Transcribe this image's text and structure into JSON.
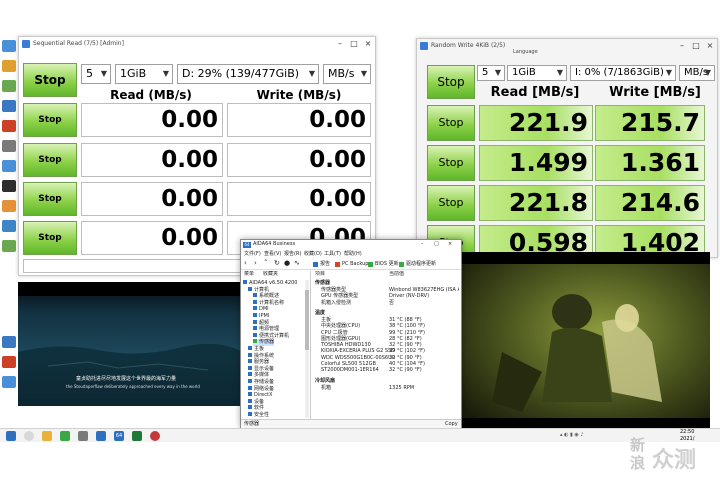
{
  "seq_window": {
    "title": "Sequential Read (7/5) [Admin]",
    "stop_main": "Stop",
    "count": "5",
    "size": "1GiB",
    "drive": "D: 29% (139/477GiB)",
    "unit": "MB/s",
    "read_header": "Read (MB/s)",
    "write_header": "Write (MB/s)",
    "rows": [
      {
        "stop": "Stop",
        "read": "0.00",
        "write": "0.00"
      },
      {
        "stop": "Stop",
        "read": "0.00",
        "write": "0.00"
      },
      {
        "stop": "Stop",
        "read": "0.00",
        "write": "0.00"
      },
      {
        "stop": "Stop",
        "read": "0.00",
        "write": "0.00"
      }
    ]
  },
  "rand_window": {
    "title": "Random Write 4KiB (2/5)",
    "menu": "Language",
    "stop_main": "Stop",
    "count": "5",
    "size": "1GiB",
    "drive": "I: 0% (7/1863GiB)",
    "unit": "MB/s",
    "read_header": "Read [MB/s]",
    "write_header": "Write [MB/s]",
    "rows": [
      {
        "stop": "Stop",
        "read": "221.9",
        "write": "215.7"
      },
      {
        "stop": "Stop",
        "read": "1.499",
        "write": "1.361"
      },
      {
        "stop": "Stop",
        "read": "221.8",
        "write": "214.6"
      },
      {
        "stop": "Stop",
        "read": "0.598",
        "write": "1.402"
      }
    ]
  },
  "aida": {
    "title": "AIDA64 Business",
    "menu": [
      "文件(F)",
      "查看(V)",
      "报告(R)",
      "收藏(O)",
      "工具(T)",
      "帮助(H)"
    ],
    "toolbar": [
      "报告",
      "PC Backup",
      "BIOS 更新",
      "驱动程序更新"
    ],
    "tabs": [
      "菜单",
      "收藏夹"
    ],
    "col_item": "项目",
    "col_value": "当前值",
    "tree": [
      "AIDA64 v6.50.4200",
      "计算机",
      "系统概述",
      "计算机名称",
      "DMI",
      "IPMI",
      "超频",
      "电源管理",
      "便携式计算机",
      "传感器",
      "主板",
      "操作系统",
      "服务器",
      "显示设备",
      "多媒体",
      "存储设备",
      "网络设备",
      "DirectX",
      "设备",
      "软件",
      "安全性"
    ],
    "sensor_section": "传感器",
    "sensor_rows": [
      {
        "name": "传感器类型",
        "value": "Winbond W83627EHG (ISA A20)"
      },
      {
        "name": "GPU 传感器类型",
        "value": "Driver (NV-DRV)"
      },
      {
        "name": "机箱入侵检测",
        "value": "否"
      }
    ],
    "temp_section": "温度",
    "temp_rows": [
      {
        "name": "主板",
        "value": "31 °C (88 °F)"
      },
      {
        "name": "中央处理器(CPU)",
        "value": "38 °C (100 °F)"
      },
      {
        "name": "CPU 二极管",
        "value": "99 °C (210 °F)"
      },
      {
        "name": "图形处理器(GPU)",
        "value": "28 °C (82 °F)"
      },
      {
        "name": "TOSHIBA HDWD130",
        "value": "32 °C (90 °F)"
      },
      {
        "name": "KIOXIA-EXCERIA PLUS G2 SSD",
        "value": "39 °C (102 °F)"
      },
      {
        "name": "WDC WDS500G1B0C-00S6U0",
        "value": "32 °C (90 °F)"
      },
      {
        "name": "Colorful SL500 512GB",
        "value": "40 °C (104 °F)"
      },
      {
        "name": "ST2000DM001-1ER164",
        "value": "32 °C (90 °F)"
      }
    ],
    "fan_section": "冷却风扇",
    "fan_rows": [
      {
        "name": "机箱",
        "value": "1325 RPM"
      }
    ],
    "status_left": "传感器",
    "status_right": "Copy"
  },
  "video_left": {
    "subtitle_cn": "童贞助托进尽尽地发展这个世界最的海军力量",
    "subtitle_en": "the Stoudaperflaw deliberately approached every way in the world"
  },
  "taskbar": {
    "time": "22:50",
    "date": "2021/"
  },
  "watermark": {
    "line1": "新",
    "line2": "浪",
    "brand": "众测"
  },
  "colors": {
    "stop_green": "#8ed24a",
    "cell_green": "#b4e474",
    "aida_accent": "#2f6fbf"
  }
}
